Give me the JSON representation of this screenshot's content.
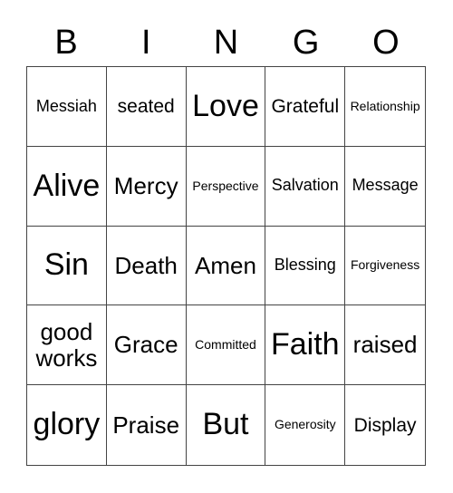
{
  "header": [
    "B",
    "I",
    "N",
    "G",
    "O"
  ],
  "cells": [
    {
      "text": "Messiah",
      "size": "s-s"
    },
    {
      "text": "seated",
      "size": "s-m"
    },
    {
      "text": "Love",
      "size": "s-xl"
    },
    {
      "text": "Grateful",
      "size": "s-m"
    },
    {
      "text": "Relationship",
      "size": "s-xs"
    },
    {
      "text": "Alive",
      "size": "s-xl"
    },
    {
      "text": "Mercy",
      "size": "s-l"
    },
    {
      "text": "Perspective",
      "size": "s-xs"
    },
    {
      "text": "Salvation",
      "size": "s-s"
    },
    {
      "text": "Message",
      "size": "s-s"
    },
    {
      "text": "Sin",
      "size": "s-xl"
    },
    {
      "text": "Death",
      "size": "s-l"
    },
    {
      "text": "Amen",
      "size": "s-l"
    },
    {
      "text": "Blessing",
      "size": "s-s"
    },
    {
      "text": "Forgiveness",
      "size": "s-xs"
    },
    {
      "text": "good works",
      "size": "s-l"
    },
    {
      "text": "Grace",
      "size": "s-l"
    },
    {
      "text": "Committed",
      "size": "s-xs"
    },
    {
      "text": "Faith",
      "size": "s-xl"
    },
    {
      "text": "raised",
      "size": "s-l"
    },
    {
      "text": "glory",
      "size": "s-xl"
    },
    {
      "text": "Praise",
      "size": "s-l"
    },
    {
      "text": "But",
      "size": "s-xl"
    },
    {
      "text": "Generosity",
      "size": "s-xs"
    },
    {
      "text": "Display",
      "size": "s-m"
    }
  ]
}
